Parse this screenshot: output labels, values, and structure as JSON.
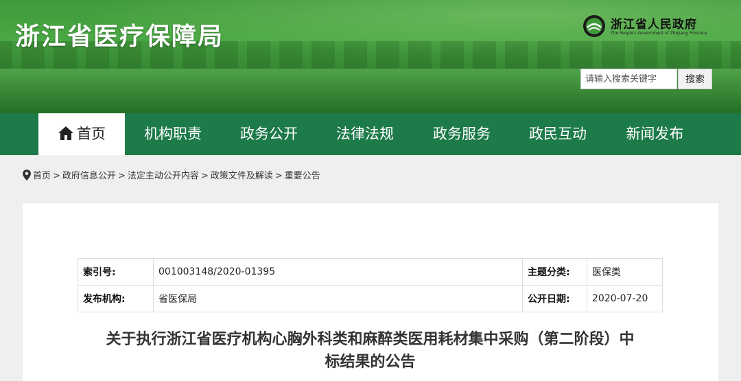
{
  "header": {
    "site_title": "浙江省医疗保障局",
    "gov_logo": {
      "name_cn": "浙江省人民政府",
      "name_en": "The People's Government of Zhejiang Province",
      "icon": "provincial-emblem-icon"
    },
    "search": {
      "placeholder": "请输入搜索关键字",
      "button_label": "搜索"
    }
  },
  "nav": {
    "items": [
      {
        "label": "首页",
        "icon": "home-icon",
        "active": true
      },
      {
        "label": "机构职责"
      },
      {
        "label": "政务公开"
      },
      {
        "label": "法律法规"
      },
      {
        "label": "政务服务"
      },
      {
        "label": "政民互动"
      },
      {
        "label": "新闻发布"
      }
    ]
  },
  "breadcrumb": {
    "icon": "location-pin-icon",
    "items": [
      "首页",
      "政府信息公开",
      "法定主动公开内容",
      "政策文件及解读",
      "重要公告"
    ],
    "separator": ">"
  },
  "meta": {
    "index_label": "索引号:",
    "index_value": "001003148/2020-01395",
    "topic_label": "主题分类:",
    "topic_value": "医保类",
    "publisher_label": "发布机构:",
    "publisher_value": "省医保局",
    "date_label": "公开日期:",
    "date_value": "2020-07-20"
  },
  "article": {
    "title_line1": "关于执行浙江省医疗机构心胸外科类和麻醉类医用耗材集中采购（第二阶段）中",
    "title_line2": "标结果的公告"
  },
  "colors": {
    "nav_bg": "#1d7a49",
    "banner_green": "#3f9a3b",
    "page_bg": "#efefef"
  }
}
